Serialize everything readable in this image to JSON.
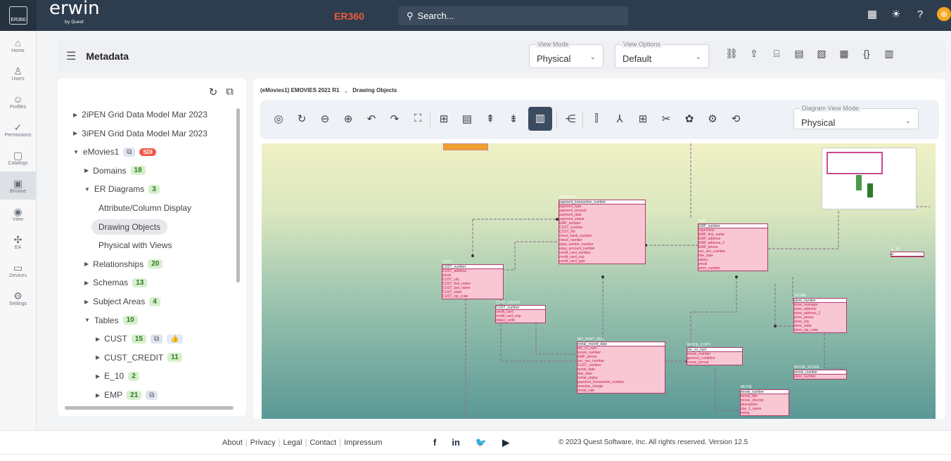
{
  "topbar": {
    "logo_text": "ER360",
    "brand": "erwin",
    "brand_sub": "by Quest",
    "app_name": "ER360",
    "search_placeholder": "Search..."
  },
  "nav": [
    {
      "label": "Home",
      "icon": "⌂"
    },
    {
      "label": "Users",
      "icon": "♙"
    },
    {
      "label": "Profiles",
      "icon": "☺"
    },
    {
      "label": "Permissions",
      "icon": "✓"
    },
    {
      "label": "Catalogs",
      "icon": "▢"
    },
    {
      "label": "Browse",
      "icon": "▣"
    },
    {
      "label": "View",
      "icon": "◉"
    },
    {
      "label": "EA",
      "icon": "✣"
    },
    {
      "label": "Devices",
      "icon": "▭"
    },
    {
      "label": "Settings",
      "icon": "⚙"
    }
  ],
  "header": {
    "title": "Metadata",
    "view_mode_label": "View Mode",
    "view_mode_value": "Physical",
    "view_options_label": "View Options",
    "view_options_value": "Default"
  },
  "tree": [
    {
      "label": "2iPEN Grid Data Model Mar 2023",
      "indent": 0,
      "arrow": "▶"
    },
    {
      "label": "3iPEN Grid Data Model Mar 2023",
      "indent": 0,
      "arrow": "▶"
    },
    {
      "label": "eMovies1",
      "indent": 0,
      "arrow": "▼",
      "badges": [
        {
          "t": "⧉",
          "c": "ic"
        },
        {
          "t": "SDI",
          "c": "sdi"
        }
      ]
    },
    {
      "label": "Domains",
      "indent": 1,
      "arrow": "▶",
      "badges": [
        {
          "t": "18",
          "c": ""
        }
      ]
    },
    {
      "label": "ER Diagrams",
      "indent": 1,
      "arrow": "▼",
      "badges": [
        {
          "t": "3",
          "c": ""
        }
      ]
    },
    {
      "label": "Attribute/Column Display",
      "indent": 2,
      "arrow": ""
    },
    {
      "label": "Drawing Objects",
      "indent": 2,
      "arrow": "",
      "selected": true
    },
    {
      "label": "Physical with Views",
      "indent": 2,
      "arrow": ""
    },
    {
      "label": "Relationships",
      "indent": 1,
      "arrow": "▶",
      "badges": [
        {
          "t": "20",
          "c": ""
        }
      ]
    },
    {
      "label": "Schemas",
      "indent": 1,
      "arrow": "▶",
      "badges": [
        {
          "t": "13",
          "c": ""
        }
      ]
    },
    {
      "label": "Subject Areas",
      "indent": 1,
      "arrow": "▶",
      "badges": [
        {
          "t": "4",
          "c": ""
        }
      ]
    },
    {
      "label": "Tables",
      "indent": 1,
      "arrow": "▼",
      "badges": [
        {
          "t": "10",
          "c": ""
        }
      ]
    },
    {
      "label": "CUST",
      "indent": 2,
      "arrow": "▶",
      "badges": [
        {
          "t": "15",
          "c": ""
        },
        {
          "t": "⧉",
          "c": "ic"
        },
        {
          "t": "👍",
          "c": "blue"
        }
      ]
    },
    {
      "label": "CUST_CREDIT",
      "indent": 2,
      "arrow": "▶",
      "badges": [
        {
          "t": "11",
          "c": ""
        }
      ]
    },
    {
      "label": "E_10",
      "indent": 2,
      "arrow": "▶",
      "badges": [
        {
          "t": "2",
          "c": ""
        }
      ]
    },
    {
      "label": "EMP",
      "indent": 2,
      "arrow": "▶",
      "badges": [
        {
          "t": "21",
          "c": ""
        },
        {
          "t": "⧉",
          "c": "ic"
        }
      ]
    }
  ],
  "breadcrumb": {
    "model": "(eMovies1) EMOVIES 2021 R1",
    "sep": ",",
    "diagram": "Drawing Objects"
  },
  "toolbar": {
    "icons": [
      "◎",
      "↻",
      "⊖",
      "⊕",
      "↶",
      "↷",
      "⛶",
      "⊞",
      "▤",
      "⇞",
      "⇟",
      "▥",
      "⋲",
      "⫿",
      "⅄",
      "⊞",
      "✂",
      "✿",
      "⚙",
      "⟲"
    ],
    "diagram_view_mode_label": "Diagram View Mode",
    "diagram_view_mode_value": "Physical"
  },
  "entities": [
    {
      "name": "PAYMENT",
      "header": "payment_transaction_number",
      "rows": [
        "payment_type",
        "payment_amount",
        "payment_date",
        "payment_status",
        "EMP_number",
        "CUST_number",
        "CUST_No",
        "check_bank_number",
        "check_number",
        "epay_vendor_number",
        "epay_account_number",
        "credit_card_number",
        "credit_card_exp",
        "credit_card_type"
      ]
    },
    {
      "name": "EMP",
      "header": "EMP_number",
      "rows": [
        "supervisor",
        "EMP_first_name",
        "EMP_address",
        "EMP_address_2",
        "EMP_phone",
        "soc_sec_number",
        "hire_date",
        "salary",
        "email",
        "store_number"
      ]
    },
    {
      "name": "CUST",
      "header": "CUST_number",
      "rows": [
        "CUST_address",
        "email",
        "CUST_city",
        "CUST_first_name",
        "CUST_last_name",
        "CUST_state",
        "CUST_zip_code"
      ]
    },
    {
      "name": "CUST_CREDIT",
      "header": "CUST_number",
      "rows": [
        "credit_card",
        "credit_card_exp",
        "status_code"
      ]
    },
    {
      "name": "MO_RENT_REC",
      "header": "rental_record_date",
      "rows": [
        "mo_co_num",
        "movie_number",
        "EMP_phone",
        "soc_sec_number",
        "CUST_number",
        "rental_date",
        "due_date",
        "rental_status",
        "payment_transaction_number",
        "overdue_charge",
        "rental_rate"
      ]
    },
    {
      "name": "MOVIE_COPY",
      "header": "mo_co_num",
      "rows": [
        "movie_number",
        "general_condition",
        "movie_format"
      ]
    },
    {
      "name": "STORE",
      "header": "store_number",
      "rows": [
        "store_manager",
        "store_address",
        "store_address_2",
        "store_phone",
        "store_city",
        "store_state",
        "store_zip_code"
      ]
    },
    {
      "name": "MOVIE_STORE",
      "header": "movie_number",
      "rows": [
        "store_number"
      ]
    },
    {
      "name": "MOVIE",
      "header": "movie_number",
      "rows": [
        "movie_title",
        "movie_director",
        "description",
        "star_1_name",
        "rating"
      ]
    },
    {
      "name": "E_10",
      "header": "a",
      "rows": []
    }
  ],
  "footer": {
    "links": [
      "About",
      "Privacy",
      "Legal",
      "Contact",
      "Impressum"
    ],
    "social": [
      "f",
      "in",
      "🐦",
      "▶"
    ],
    "copyright": "© 2023 Quest Software, Inc. All rights reserved. Version 12.5"
  }
}
